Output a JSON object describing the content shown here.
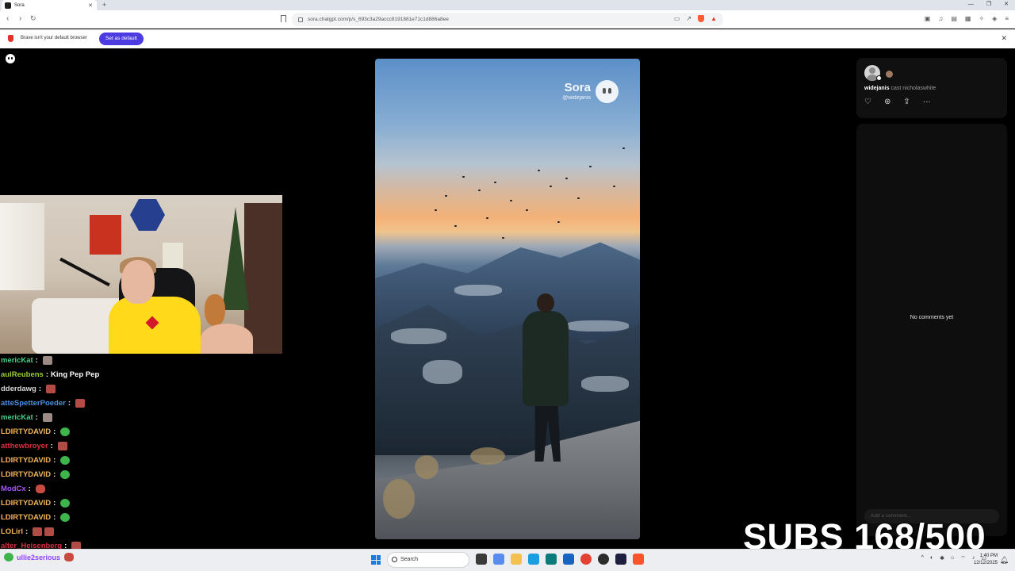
{
  "browser": {
    "tab_title": "Sora",
    "new_tab": "+",
    "url": "sora.chatgpt.com/p/s_693c3a29accc8191881e71c1d886a8ee",
    "infobar_message": "Brave isn't your default browser",
    "infobar_button": "Set as default"
  },
  "video": {
    "watermark_title": "Sora",
    "watermark_user": "@widejanis"
  },
  "post": {
    "author": "widejanis",
    "cast_label": "cast",
    "cast_user": "nicholaswhite",
    "no_comments": "No comments yet",
    "comment_placeholder": "Add a comment..."
  },
  "chat": [
    {
      "user": "mericKat",
      "color": "#46d08a",
      "emotes": [
        "face"
      ]
    },
    {
      "user": "aulReubens",
      "color": "#9acd32",
      "message": "King Pep Pep"
    },
    {
      "user": "dderdawg",
      "color": "#d7d7d7",
      "emotes": [
        "kick"
      ]
    },
    {
      "user": "atteSpetterPoeder",
      "color": "#4a8fe0",
      "emotes": [
        "kick"
      ]
    },
    {
      "user": "mericKat",
      "color": "#46d08a",
      "emotes": [
        "face"
      ]
    },
    {
      "user": "LDIRTYDAVID",
      "color": "#f2b45a",
      "emotes": [
        "pepe"
      ]
    },
    {
      "user": "atthewbroyer",
      "color": "#d8303c",
      "emotes": [
        "kick"
      ]
    },
    {
      "user": "LDIRTYDAVID",
      "color": "#f2b45a",
      "emotes": [
        "pepe"
      ]
    },
    {
      "user": "LDIRTYDAVID",
      "color": "#f2b45a",
      "emotes": [
        "pepe"
      ]
    },
    {
      "user": "ModCx",
      "color": "#a855f7",
      "emotes": [
        "bear"
      ]
    },
    {
      "user": "LDIRTYDAVID",
      "color": "#f2b45a",
      "emotes": [
        "pepe"
      ]
    },
    {
      "user": "LDIRTYDAVID",
      "color": "#f2b45a",
      "emotes": [
        "pepe"
      ]
    },
    {
      "user": "LOLirl",
      "color": "#f2b45a",
      "emotes": [
        "kick",
        "kick"
      ]
    },
    {
      "user": "alter_Heisenberg",
      "color": "#d8303c",
      "emotes": [
        "kick"
      ]
    }
  ],
  "overlay": {
    "subs_text": "SUBS 168/500",
    "bottom_chat_user": "ullie2serious"
  },
  "taskbar": {
    "search_label": "Search",
    "time": "1:40 PM",
    "date": "12/12/2025"
  }
}
